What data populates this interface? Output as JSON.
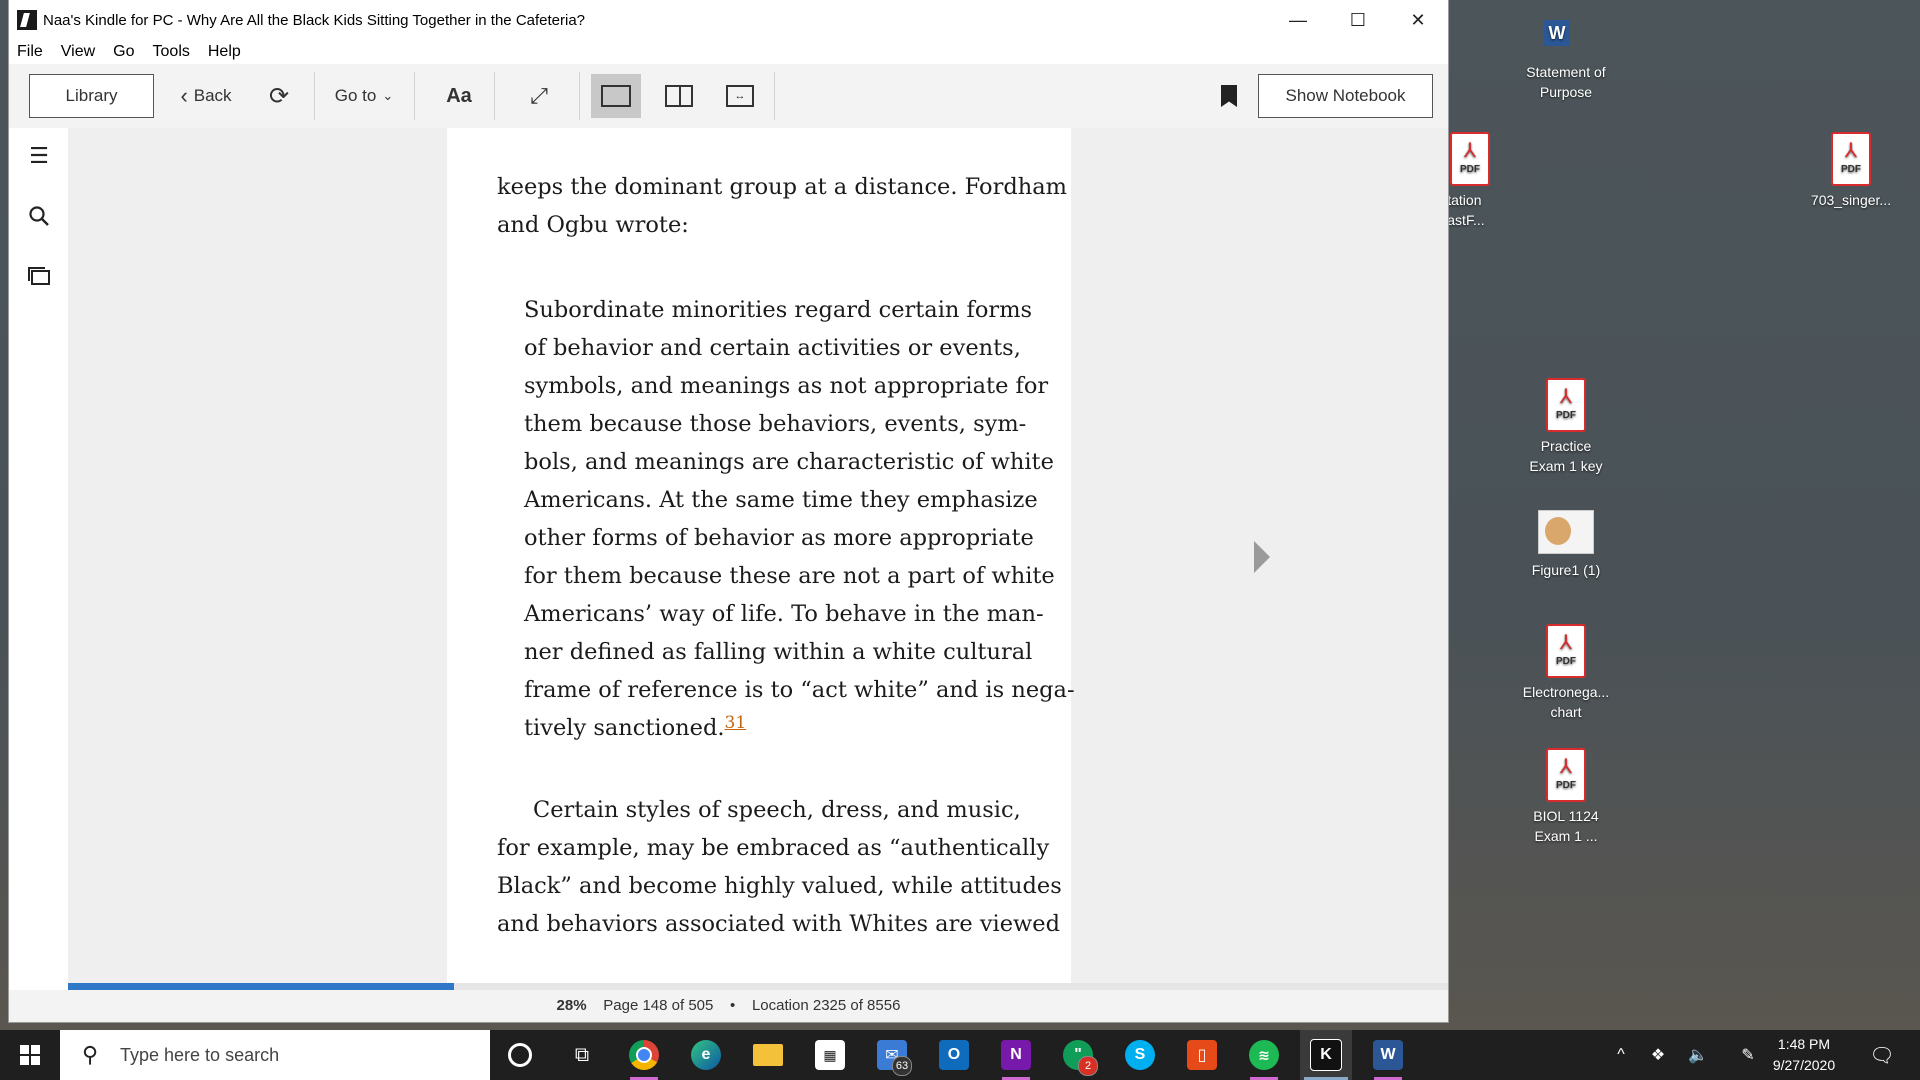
{
  "window": {
    "title": "Naa's Kindle for PC - Why Are All the Black Kids Sitting Together in the Cafeteria?",
    "minimize": "—",
    "maximize": "☐",
    "close": "✕"
  },
  "menu": [
    "File",
    "View",
    "Go",
    "Tools",
    "Help"
  ],
  "toolbar": {
    "library": "Library",
    "back": "Back",
    "goto": "Go to",
    "font": "Aa",
    "show_notebook": "Show Notebook"
  },
  "book": {
    "para1": [
      "keeps the dominant group at a distance. Fordham",
      "and Ogbu wrote:"
    ],
    "quote": [
      "Subordinate minorities regard certain forms",
      "of behavior and certain activities or events,",
      "symbols, and meanings as not appropriate for",
      "them because those behaviors, events, sym-",
      "bols, and meanings are characteristic of white",
      "Americans. At the same time they emphasize",
      "other forms of behavior as more appropriate",
      "for them because these are not a part of white",
      "Americans’ way of life. To behave in the man-",
      "ner defined as falling within a white cultural",
      "frame of reference is to “act white” and is nega-",
      "tively sanctioned."
    ],
    "footnote": "31",
    "para2": [
      "Certain styles of speech, dress, and music,",
      "for example, may be embraced as “authentically",
      "Black” and become highly valued, while attitudes",
      "and behaviors associated with Whites are viewed"
    ]
  },
  "status": {
    "percent": "28%",
    "page": "Page 148 of 505",
    "separator": "•",
    "location": "Location 2325 of 8556",
    "progress_fraction": 0.28
  },
  "desktop": {
    "icons": [
      {
        "name": "Statement of Purpose",
        "line1": "Statement of",
        "line2": "Purpose",
        "type": "word"
      },
      {
        "line1": "mentation",
        "line2": "h YeastF...",
        "type": "pdf"
      },
      {
        "line1": "703_singer...",
        "line2": "",
        "type": "pdf"
      },
      {
        "line1": "Practice",
        "line2": "Exam 1 key",
        "type": "pdf"
      },
      {
        "line1": "Figure1 (1)",
        "line2": "",
        "type": "image"
      },
      {
        "line1": "Electronega...",
        "line2": "chart",
        "type": "pdf"
      },
      {
        "line1": "BIOL 1124",
        "line2": "Exam 1 ...",
        "type": "pdf"
      }
    ],
    "pdf_label": "PDF"
  },
  "taskbar": {
    "search_placeholder": "Type here to search",
    "mail_badge": "63",
    "onenote_badge": "2",
    "time": "1:48 PM",
    "date": "9/27/2020"
  }
}
